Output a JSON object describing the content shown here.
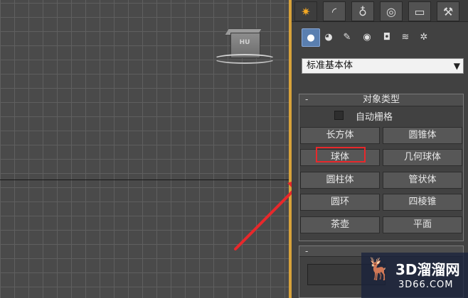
{
  "viewport": {
    "cube_label": "HU"
  },
  "command_panel": {
    "tabs": [
      {
        "name": "create",
        "icon": "sun-icon"
      },
      {
        "name": "modify",
        "icon": "curve-icon"
      },
      {
        "name": "hierarchy",
        "icon": "hierarchy-icon"
      },
      {
        "name": "motion",
        "icon": "motion-icon"
      },
      {
        "name": "display",
        "icon": "monitor-icon"
      },
      {
        "name": "utilities",
        "icon": "hammer-icon"
      }
    ],
    "categories": [
      {
        "name": "geometry",
        "icon": "sphere-icon"
      },
      {
        "name": "shapes",
        "icon": "shapes-icon"
      },
      {
        "name": "lights",
        "icon": "light-icon"
      },
      {
        "name": "cameras",
        "icon": "camera-icon"
      },
      {
        "name": "helpers",
        "icon": "helper-icon"
      },
      {
        "name": "space-warps",
        "icon": "wave-icon"
      },
      {
        "name": "systems",
        "icon": "gears-icon"
      }
    ],
    "dropdown": {
      "value": "标准基本体"
    },
    "object_type": {
      "collapse_symbol": "-",
      "title": "对象类型",
      "auto_grid_label": "自动栅格",
      "buttons": [
        "长方体",
        "圆锥体",
        "球体",
        "几何球体",
        "圆柱体",
        "管状体",
        "圆环",
        "四棱锥",
        "茶壶",
        "平面"
      ],
      "highlight_color": "#e8282b"
    },
    "name_color": {
      "collapse_symbol": "-"
    }
  },
  "watermark": {
    "title": "3D溜溜网",
    "subtitle": "3D66.COM"
  },
  "colors": {
    "accent": "#f4a823",
    "arrow": "#e8282b",
    "viewport_border": "#d8a23a"
  }
}
